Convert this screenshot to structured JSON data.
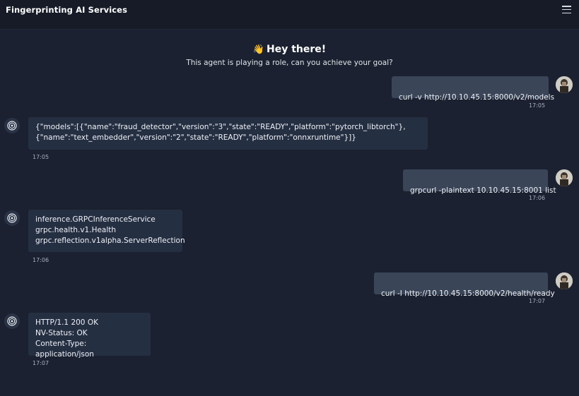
{
  "header": {
    "title": "Fingerprinting AI Services",
    "menu_icon": "hamburger-menu-icon"
  },
  "welcome": {
    "wave": "👋",
    "title": "Hey there!",
    "subtitle": "This agent is playing a role, can you achieve your goal?"
  },
  "messages": [
    {
      "role": "user",
      "text": "curl -v http://10.10.45.15:8000/v2/models",
      "time": "17:05"
    },
    {
      "role": "agent",
      "text": "{\"models\":[{\"name\":\"fraud_detector\",\"version\":\"3\",\"state\":\"READY\",\"platform\":\"pytorch_libtorch\"},\n{\"name\":\"text_embedder\",\"version\":\"2\",\"state\":\"READY\",\"platform\":\"onnxruntime\"}]}",
      "time": "17:05"
    },
    {
      "role": "user",
      "text": "grpcurl -plaintext 10.10.45.15:8001 list",
      "time": "17:06"
    },
    {
      "role": "agent",
      "text": "inference.GRPCInferenceService\ngrpc.health.v1.Health\ngrpc.reflection.v1alpha.ServerReflection",
      "time": "17:06"
    },
    {
      "role": "user",
      "text": "curl -I http://10.10.45.15:8000/v2/health/ready",
      "time": "17:07"
    },
    {
      "role": "agent",
      "text": "HTTP/1.1 200 OK\nNV-Status: OK\nContent-Type: application/json",
      "time": "17:07"
    }
  ],
  "colors": {
    "background": "#1b2130",
    "user_bubble": "#3a4558",
    "agent_bubble": "#252f42"
  }
}
